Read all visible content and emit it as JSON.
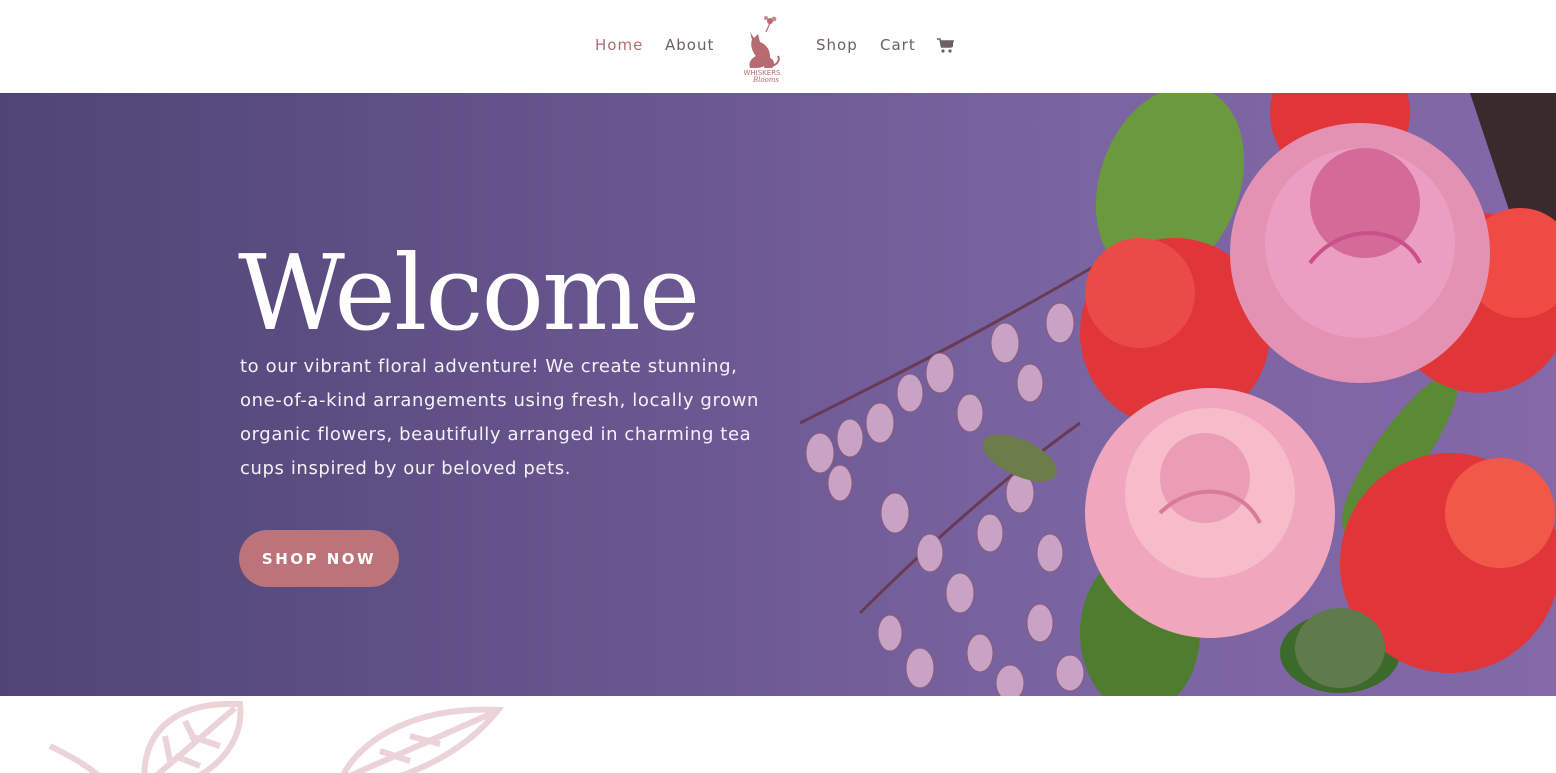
{
  "nav": {
    "items": [
      {
        "label": "Home",
        "active": true
      },
      {
        "label": "About",
        "active": false
      },
      {
        "label": "Shop",
        "active": false
      },
      {
        "label": "Cart",
        "active": false
      }
    ],
    "cart_icon": "cart-icon",
    "logo": {
      "line1": "WHISKERS",
      "line2": "Blooms"
    }
  },
  "hero": {
    "title": "Welcome",
    "text": "to our vibrant floral adventure! We create stunning, one-of-a-kind arrangements using fresh, locally grown organic flowers, beautifully arranged in charming tea cups inspired by our beloved pets.",
    "button_label": "SHOP NOW"
  },
  "colors": {
    "accent": "#b56b71",
    "button": "#bc7379",
    "hero_gradient_start": "#4f4575",
    "hero_gradient_end": "#8468a8"
  }
}
